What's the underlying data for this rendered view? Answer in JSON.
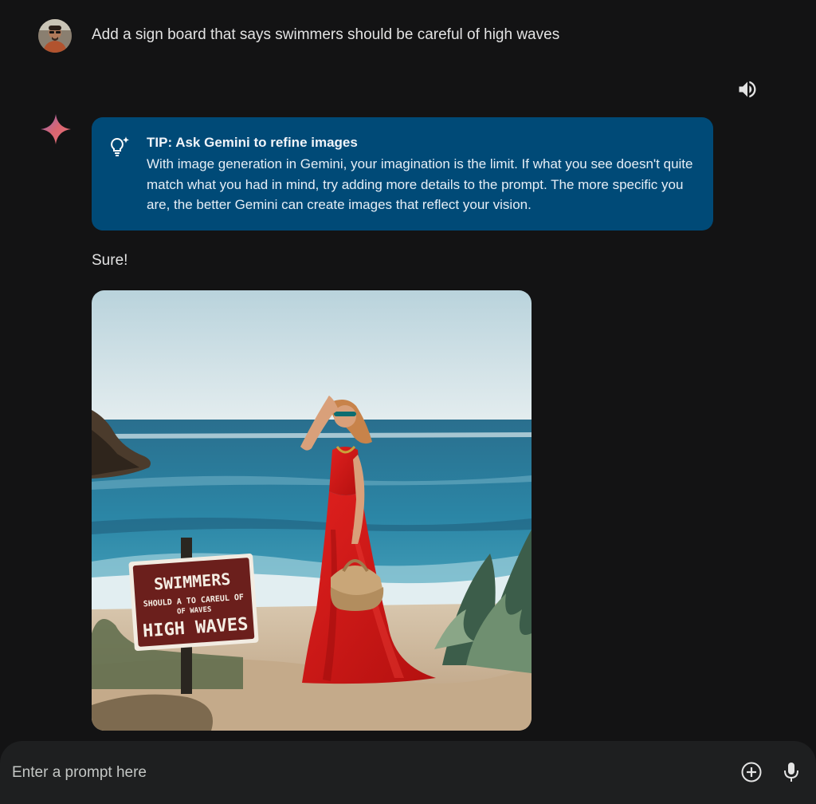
{
  "user_message": {
    "text": "Add a sign board that says swimmers should be careful of high waves"
  },
  "response": {
    "tip": {
      "title": "TIP: Ask Gemini to refine images",
      "body": "With image generation in Gemini, your imagination is the limit. If what you see doesn't quite match what you had in mind, try adding more details to the prompt. The more specific you are, the better Gemini can create images that reflect your vision."
    },
    "reply_text": "Sure!",
    "image": {
      "sign_line1": "SWIMMERS",
      "sign_line2": "SHOULD A TO CAREUL OF",
      "sign_line3": "OF WAVES",
      "sign_line4": "HIGH WAVES"
    }
  },
  "input": {
    "placeholder": "Enter a prompt here"
  },
  "icons": {
    "speaker": "speaker-icon",
    "tip": "lightbulb-sparkle-icon",
    "gemini": "gemini-spark-icon",
    "add": "add-circle-icon",
    "mic": "microphone-icon"
  },
  "colors": {
    "background": "#131314",
    "tip_card": "#004a77",
    "input_bar": "#1e1f20"
  }
}
